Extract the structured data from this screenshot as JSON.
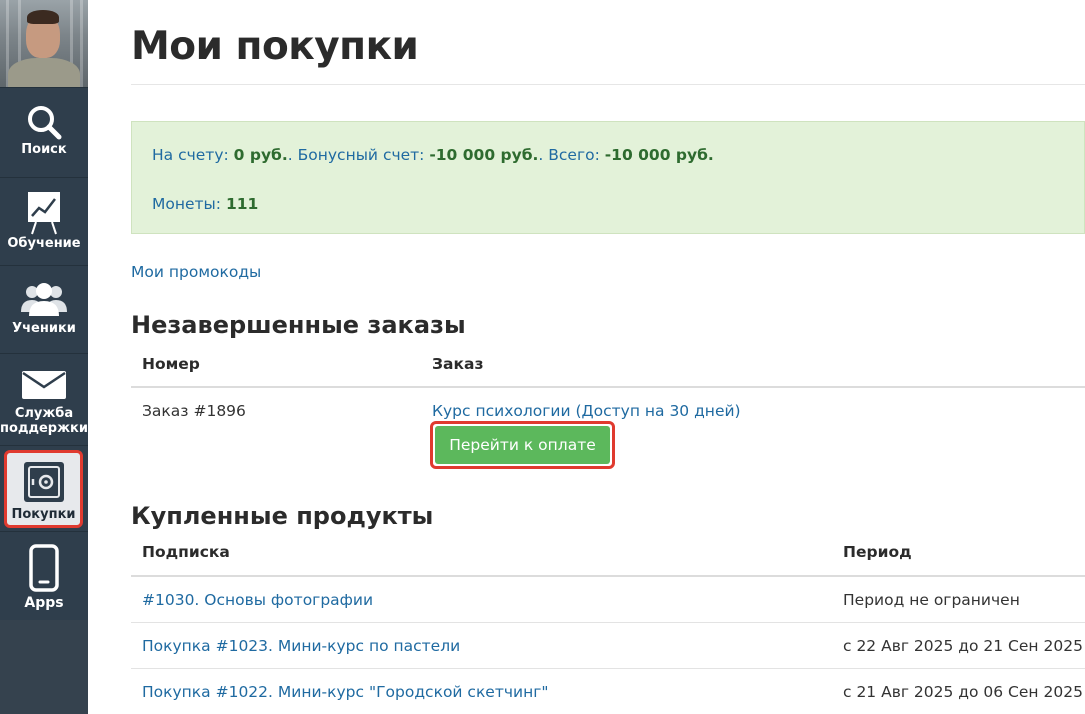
{
  "sidebar": {
    "items": [
      {
        "label": "Поиск",
        "icon": "search-icon"
      },
      {
        "label": "Обучение",
        "icon": "chart-board-icon"
      },
      {
        "label": "Ученики",
        "icon": "users-icon"
      },
      {
        "label": "Служба поддержки",
        "icon": "envelope-icon"
      },
      {
        "label": "Покупки",
        "icon": "safe-icon"
      },
      {
        "label": "Apps",
        "icon": "smartphone-icon"
      }
    ],
    "active_index": 4
  },
  "page": {
    "title": "Мои покупки"
  },
  "balance": {
    "account_label": "На счету:",
    "account_value": "0 руб.",
    "bonus_label": ". Бонусный счет:",
    "bonus_value": "-10 000 руб.",
    "total_label": ". Всего:",
    "total_value": "-10 000 руб.",
    "coins_label": "Монеты:",
    "coins_value": "111"
  },
  "promo_link": "Мои промокоды",
  "unfinished_orders": {
    "title": "Незавершенные заказы",
    "columns": [
      "Номер",
      "Заказ"
    ],
    "rows": [
      {
        "number": "Заказ #1896",
        "order": "Курс психологии (Доступ на 30 дней)",
        "pay_label": "Перейти к оплате"
      }
    ]
  },
  "purchased_products": {
    "title": "Купленные продукты",
    "columns": [
      "Подписка",
      "Период"
    ],
    "rows": [
      {
        "subscription": "#1030. Основы фотографии",
        "period": "Период не ограничен"
      },
      {
        "subscription": "Покупка #1023. Мини-курс по пастели",
        "period": "с 22 Авг 2025 до 21 Сен 2025"
      },
      {
        "subscription": "Покупка #1022. Мини-курс \"Городской скетчинг\"",
        "period": "с 21 Авг 2025 до 06 Сен 2025"
      }
    ]
  },
  "colors": {
    "sidebar_bg": "#2f3e4c",
    "link": "#1f6aa1",
    "success_bg": "#e3f2d9",
    "button_green": "#5cb85c",
    "highlight_red": "#e03a2f"
  }
}
